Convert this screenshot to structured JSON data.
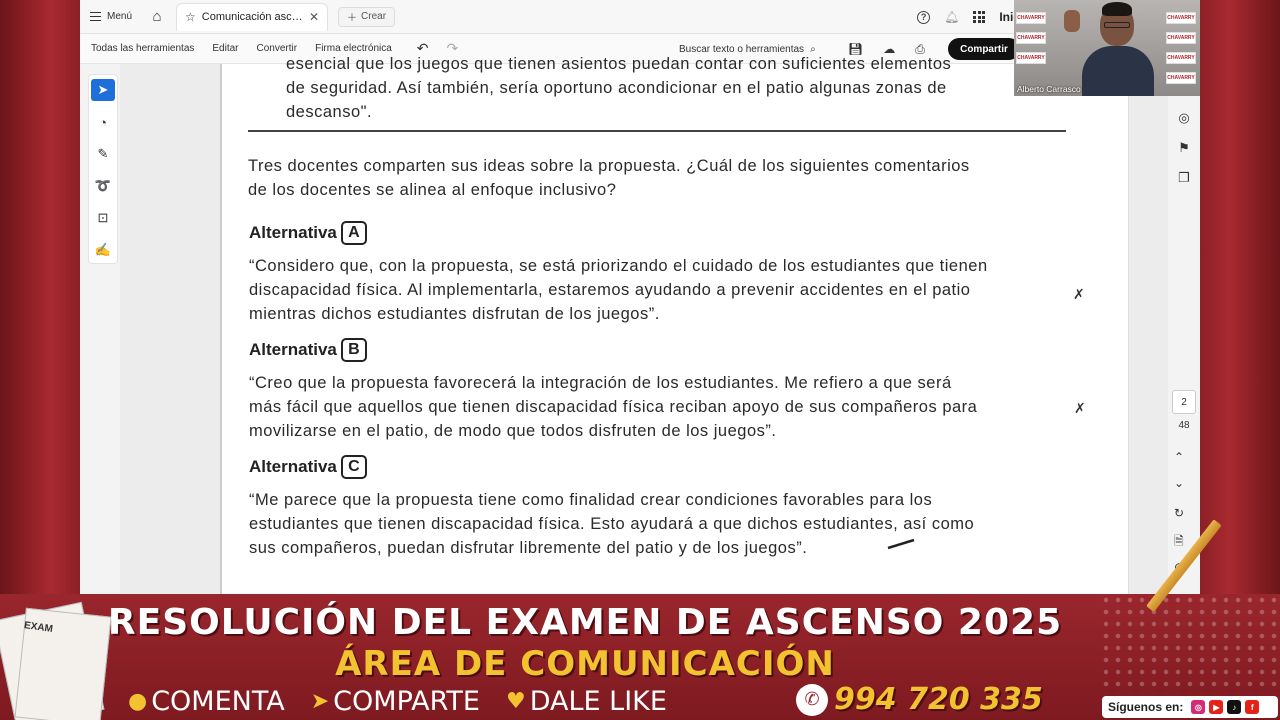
{
  "tabbar": {
    "menu_label": "Menú",
    "tab_title": "Comunicación ascens...",
    "new_tab_label": "Crear",
    "user_label": "Inic"
  },
  "toolbar": {
    "all_tools": "Todas las herramientas",
    "edit": "Editar",
    "convert": "Convertir",
    "esign": "Firma electrónica",
    "search": "Buscar texto o herramientas",
    "share": "Compartir"
  },
  "document": {
    "top_quote_lines": [
      "esencial que los juegos que tienen asientos puedan contar con suficientes elementos",
      "de seguridad. Así también, sería oportuno acondicionar en el patio algunas zonas de",
      "descanso\"."
    ],
    "question_lines": [
      "Tres docentes comparten sus ideas sobre la propuesta. ¿Cuál de los siguientes comentarios",
      "de los docentes se alinea al enfoque inclusivo?"
    ],
    "alternative_word": "Alternativa",
    "alternatives": [
      {
        "letter": "A",
        "lines": [
          "“Considero que, con la propuesta, se está priorizando el cuidado de los estudiantes que tienen",
          "discapacidad física. Al implementarla, estaremos ayudando a prevenir accidentes en el patio",
          "mientras dichos estudiantes disfrutan de los juegos”."
        ]
      },
      {
        "letter": "B",
        "lines": [
          "“Creo que la propuesta favorecerá la integración de los estudiantes. Me refiero a que será",
          "más fácil que aquellos que tienen discapacidad física reciban apoyo de sus compañeros para",
          "movilizarse en el patio, de modo que todos disfruten de los juegos”."
        ]
      },
      {
        "letter": "C",
        "lines": [
          "“Me parece que la propuesta tiene como finalidad crear condiciones favorables para los",
          "estudiantes que tienen discapacidad física. Esto ayudará a que dichos estudiantes, así como",
          "sus compañeros, puedan disfrutar libremente del patio y de los juegos”."
        ]
      }
    ]
  },
  "page_nav": {
    "current_page": "2",
    "total_pages": "48"
  },
  "webcam": {
    "name": "Alberto Carrasco",
    "logo_text": "CHAVARRY"
  },
  "banner": {
    "line1": "RESOLUCIÓN DEL EXAMEN DE ASCENSO 2025",
    "line2": "ÁREA DE COMUNICACIÓN",
    "cta_comment": "COMENTA",
    "cta_share": "COMPARTE",
    "cta_like": "DALE LIKE",
    "phone": "994 720 335",
    "follow_label": "Síguenos en:",
    "sheet_label": "EXAM"
  },
  "colors": {
    "banner_red": "#9a262d",
    "banner_yellow": "#f2c230",
    "accent_blue": "#1f6fdb"
  }
}
